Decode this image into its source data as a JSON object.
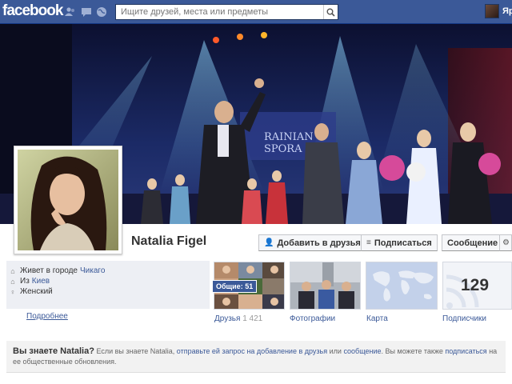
{
  "topbar": {
    "logo": "facebook",
    "search_placeholder": "Ищите друзей, места или предметы",
    "user_short": "Яр"
  },
  "profile": {
    "name": "Natalia Figel",
    "actions": {
      "add_friend": "Добавить в друзья",
      "subscribe": "Подписаться",
      "message": "Сообщение"
    }
  },
  "cover": {
    "banner_text_1": "RAINIAN",
    "banner_text_2": "SPORA"
  },
  "info": {
    "lives_prefix": "Живет в городе",
    "lives_city": "Чикаго",
    "from_prefix": "Из",
    "from_city": "Киев",
    "gender": "Женский",
    "more": "Подробнее"
  },
  "tiles": {
    "friends_label": "Друзья",
    "friends_count": "1 421",
    "mutual_badge": "Общие: 51",
    "photos_label": "Фотографии",
    "map_label": "Карта",
    "subscribers_label": "Подписчики",
    "subscribers_count": "129"
  },
  "know_box": {
    "title": "Вы знаете Natalia?",
    "text_1": "Если вы знаете Natalia,",
    "link_1": "отправьте ей запрос на добавление в друзья",
    "text_2": "или",
    "link_2": "сообщение",
    "text_3": ". Вы можете также",
    "link_3": "подписаться",
    "text_4": "на ее общественные обновления."
  },
  "colors": {
    "brand": "#3b5998",
    "link": "#3b5998"
  }
}
